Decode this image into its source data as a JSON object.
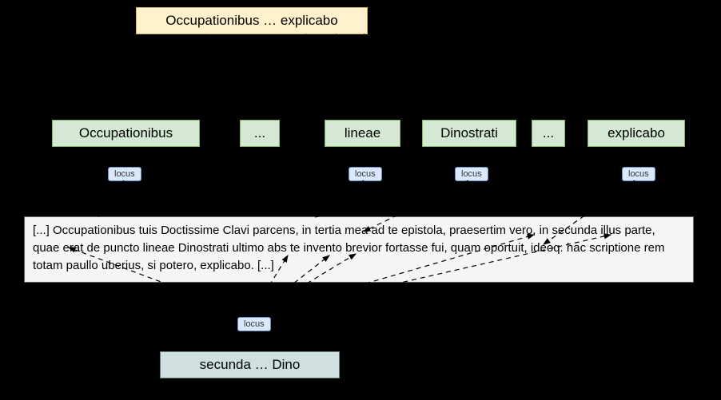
{
  "header": {
    "title": "Occupationibus … explicabo"
  },
  "words": {
    "w1": "Occupationibus",
    "w2": "...",
    "w3": "lineae",
    "w4": "Dinostrati",
    "w5": "...",
    "w6": "explicabo"
  },
  "locus_label": "locus",
  "paragraph_text": "[...] Occupationibus tuis Doctissime Clavi parcens, in tertia mea ad te epistola, praesertim vero, in secunda illus parte, quae erat de puncto lineae Dinostrati ultimo abs te invento brevior fortasse fui, quam oportuit, ideoq. hac scriptione rem totam paullo uberius, si potero, explicabo. [...]",
  "bottom": {
    "title": "secunda … Dino"
  }
}
